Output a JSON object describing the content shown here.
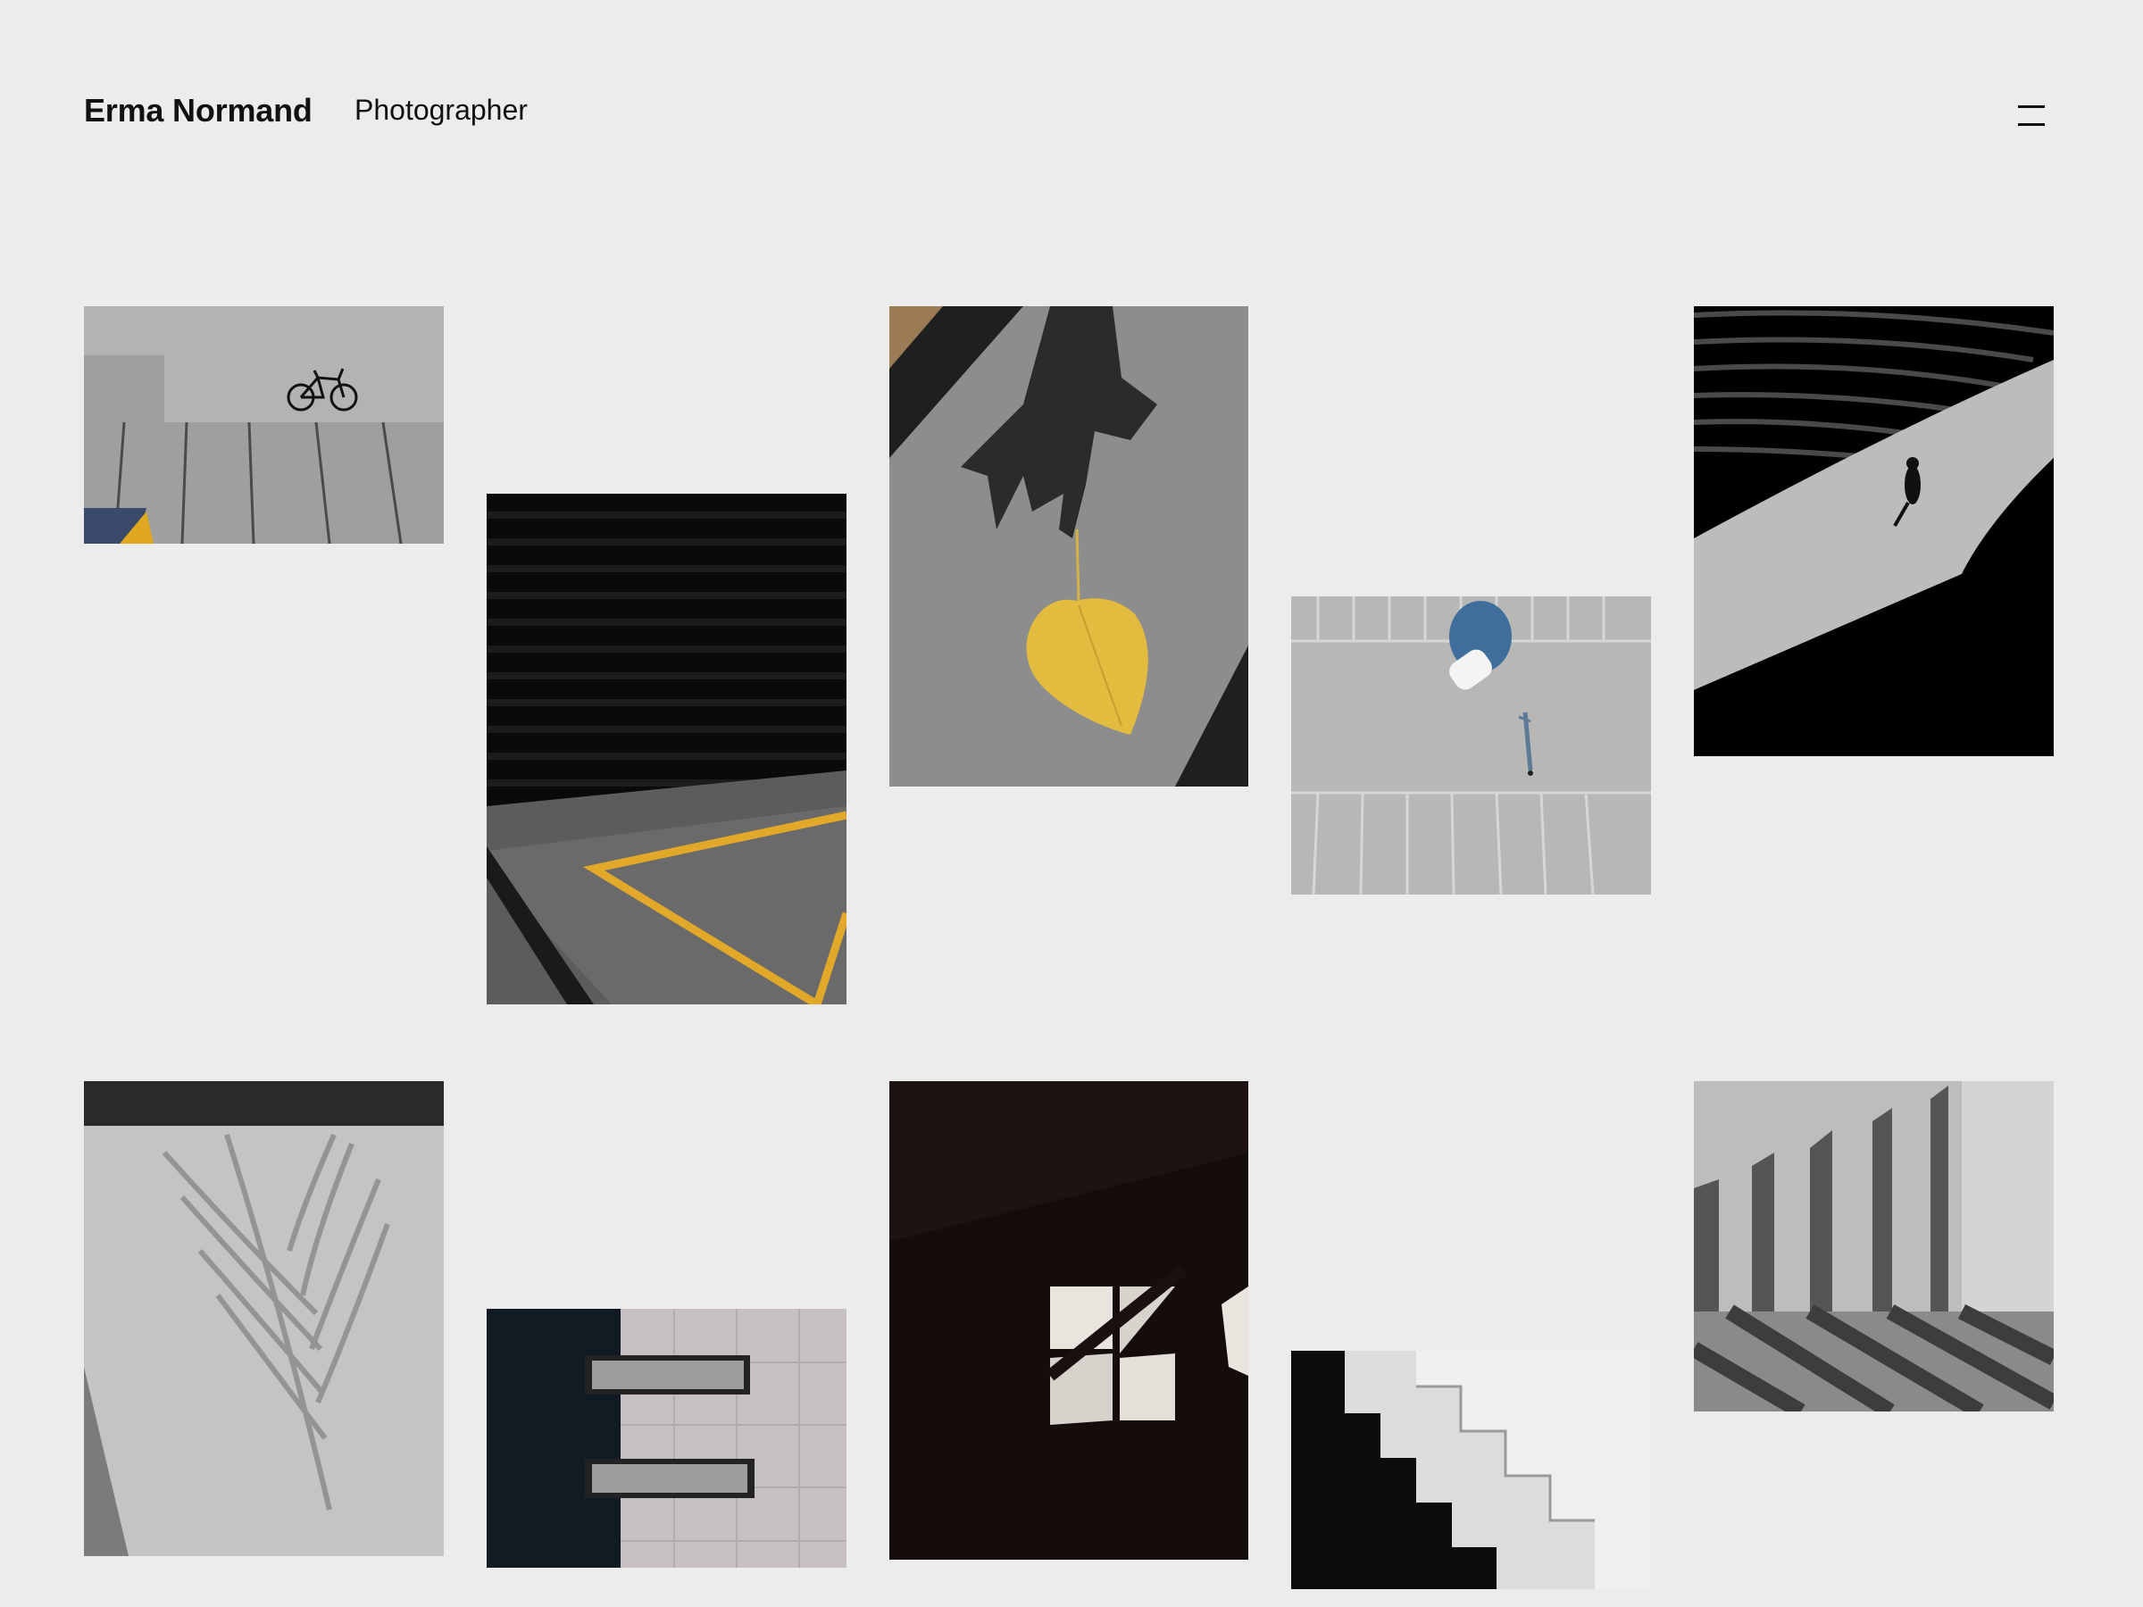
{
  "header": {
    "name": "Erma Normand",
    "role": "Photographer",
    "menu_icon": "hamburger-menu-icon"
  },
  "gallery": {
    "photos": [
      {
        "subject": "bicycle on sidewalk"
      },
      {
        "subject": "dark garage with yellow parking line"
      },
      {
        "subject": "hand shadow holding yellow leaf"
      },
      {
        "subject": "aerial car in parking lot"
      },
      {
        "subject": "person walking on curved path"
      },
      {
        "subject": "palm shadow on textured wall"
      },
      {
        "subject": "building facade with windows"
      },
      {
        "subject": "window light in dark room"
      },
      {
        "subject": "white staircase"
      },
      {
        "subject": "concrete wall with striped shadows"
      }
    ]
  }
}
